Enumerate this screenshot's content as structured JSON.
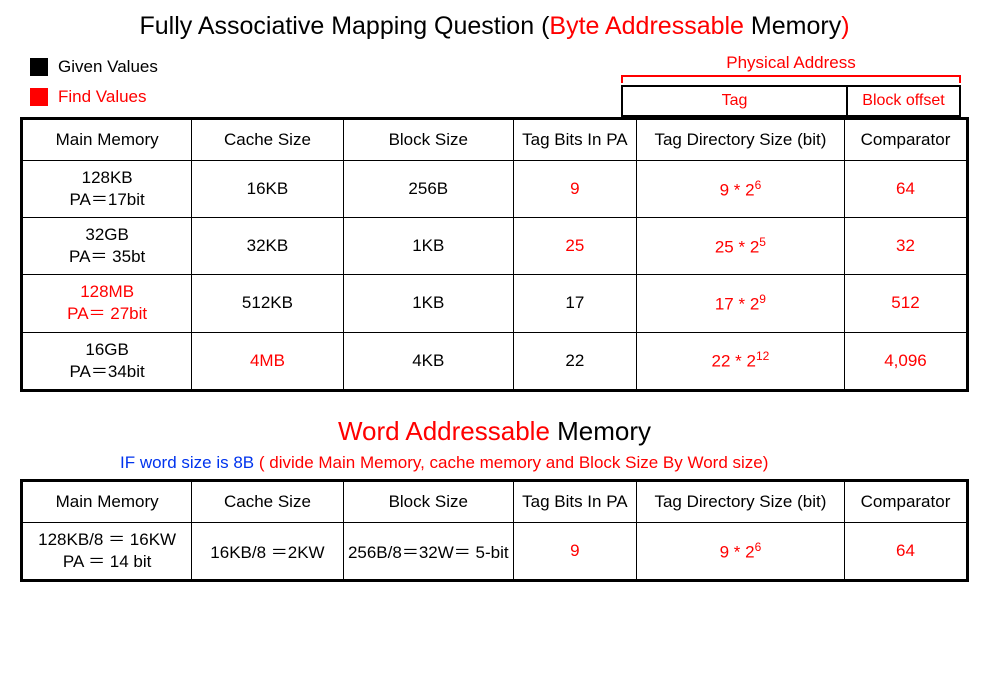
{
  "title_main": "Fully Associative Mapping Question ",
  "title_paren_open": "(",
  "title_red": "Byte Addressable ",
  "title_mem": "Memory",
  "title_paren_close": ")",
  "legend_given": "Given Values",
  "legend_find": "Find Values",
  "pa_label": "Physical Address",
  "pa_tag": "Tag",
  "pa_offset": "Block offset",
  "headers": {
    "mm": "Main  Memory",
    "cache": "Cache Size",
    "block": "Block Size",
    "tagbits": "Tag Bits In PA",
    "dir": "Tag Directory Size (bit)",
    "comp": "Comparator"
  },
  "rows": [
    {
      "mm_l1": "128KB",
      "mm_l2": "PA＝17bit",
      "mm_red": false,
      "cache": "16KB",
      "cache_red": false,
      "block": "256B",
      "block_red": false,
      "tagbits": "9",
      "tagbits_red": true,
      "dir_base": "9 * 2",
      "dir_exp": "6",
      "dir_red": true,
      "comp": "64",
      "comp_red": true
    },
    {
      "mm_l1": "32GB",
      "mm_l2": "PA＝ 35bt",
      "mm_red": false,
      "cache": "32KB",
      "cache_red": false,
      "block": "1KB",
      "block_red": false,
      "tagbits": "25",
      "tagbits_red": true,
      "dir_base": "25 * 2",
      "dir_exp": "5",
      "dir_red": true,
      "comp": "32",
      "comp_red": true
    },
    {
      "mm_l1": "128MB",
      "mm_l2": "PA＝ 27bit",
      "mm_red": true,
      "cache": "512KB",
      "cache_red": false,
      "block": "1KB",
      "block_red": false,
      "tagbits": "17",
      "tagbits_red": false,
      "dir_base": "17 * 2",
      "dir_exp": "9",
      "dir_red": true,
      "comp": "512",
      "comp_red": true
    },
    {
      "mm_l1": "16GB",
      "mm_l2": "PA＝34bit",
      "mm_red": false,
      "cache": "4MB",
      "cache_red": true,
      "block": "4KB",
      "block_red": false,
      "tagbits": "22",
      "tagbits_red": false,
      "dir_base": "22 * 2",
      "dir_exp": "12",
      "dir_red": true,
      "comp": "4,096",
      "comp_red": true
    }
  ],
  "title2_red": "Word Addressable ",
  "title2_black": "Memory",
  "sub_blue": "IF word size is 8B ",
  "sub_red": "( divide Main Memory, cache memory and Block Size By Word size)",
  "row2": {
    "mm_l1": "128KB/8 ＝ 16KW",
    "mm_l2": "PA ＝ 14 bit",
    "cache": "16KB/8 ＝2KW",
    "block": "256B/8＝32W＝ 5-bit",
    "tagbits": "9",
    "dir_base": "9 * 2",
    "dir_exp": "6",
    "comp": "64"
  }
}
